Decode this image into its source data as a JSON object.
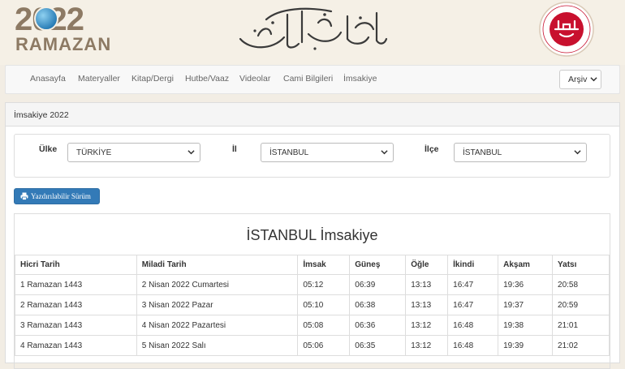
{
  "header": {
    "logo_year": "2022",
    "logo_word": "RAMAZAN",
    "seal_alt": "Diyanet İşleri Başkanlığı"
  },
  "nav": {
    "items": [
      "Anasayfa",
      "Materyaller",
      "Kitap/Dergi",
      "Hutbe/Vaaz",
      "Videolar",
      "Cami Bilgileri",
      "İmsakiye"
    ],
    "archive": "Arşiv"
  },
  "panel": {
    "title": "İmsakiye 2022"
  },
  "filters": {
    "country_label": "Ülke",
    "country_value": "TÜRKİYE",
    "province_label": "İl",
    "province_value": "İSTANBUL",
    "district_label": "İlçe",
    "district_value": "İSTANBUL"
  },
  "print_button": "Yazdırılabilir Sürüm",
  "table": {
    "title": "İSTANBUL İmsakiye",
    "headers": [
      "Hicri Tarih",
      "Miladi Tarih",
      "İmsak",
      "Güneş",
      "Öğle",
      "İkindi",
      "Akşam",
      "Yatsı"
    ],
    "rows": [
      [
        "1 Ramazan 1443",
        "2 Nisan 2022 Cumartesi",
        "05:12",
        "06:39",
        "13:13",
        "16:47",
        "19:36",
        "20:58"
      ],
      [
        "2 Ramazan 1443",
        "3 Nisan 2022 Pazar",
        "05:10",
        "06:38",
        "13:13",
        "16:47",
        "19:37",
        "20:59"
      ],
      [
        "3 Ramazan 1443",
        "4 Nisan 2022 Pazartesi",
        "05:08",
        "06:36",
        "13:12",
        "16:48",
        "19:38",
        "21:01"
      ],
      [
        "4 Ramazan 1443",
        "5 Nisan 2022 Salı",
        "05:06",
        "06:35",
        "13:12",
        "16:48",
        "19:39",
        "21:02"
      ]
    ]
  },
  "colors": {
    "accent": "#337ab7",
    "logo": "#8d7a64",
    "seal": "#c8102e",
    "background": "#f2ede4"
  }
}
